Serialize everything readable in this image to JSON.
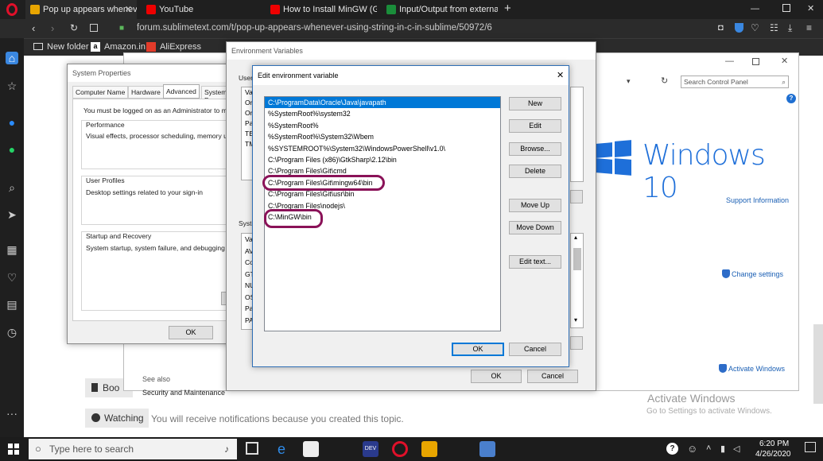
{
  "browser": {
    "tabs": [
      {
        "label": "Pop up appears whenever",
        "color": "#e8a500"
      },
      {
        "label": "YouTube",
        "color": "#e00"
      },
      {
        "label": "How to Install MinGW (GCC",
        "color": "#e00"
      },
      {
        "label": "Input/Output from externa",
        "color": "#1a8d3a"
      }
    ],
    "new_tab": "+",
    "url": "forum.sublimetext.com/t/pop-up-appears-whenever-using-string-in-c-in-sublime/50972/6",
    "bookmarks": [
      {
        "label": "New folder"
      },
      {
        "label": "Amazon.in"
      },
      {
        "label": "AliExpress"
      }
    ]
  },
  "page": {
    "bookmark_label": "Boo",
    "watching_label": "Watching",
    "notice": "You will notifications because you created this topic.",
    "notice_full": "You will receive notifications because you created this topic."
  },
  "control_panel": {
    "search_placeholder": "Search Control Panel",
    "brand": "Windows 10",
    "support": "Support Information",
    "change_settings": "Change settings",
    "activate_link": "Activate Windows",
    "see_also": "See also",
    "security": "Security and Maintenance",
    "watermark_title": "Activate Windows",
    "watermark_sub": "Go to Settings to activate Windows."
  },
  "system_properties": {
    "title": "System Properties",
    "tabs": [
      "Computer Name",
      "Hardware",
      "Advanced",
      "System P"
    ],
    "admin_note": "You must be logged on as an Administrator to make",
    "perf_title": "Performance",
    "perf_desc": "Visual effects, processor scheduling, memory usag",
    "profiles_title": "User Profiles",
    "profiles_desc": "Desktop settings related to your sign-in",
    "startup_title": "Startup and Recovery",
    "startup_desc": "System startup, system failure, and debugging info",
    "ok": "OK"
  },
  "env_vars": {
    "title": "Environment Variables",
    "user_label": "User",
    "user_col": "Va",
    "user_rows": [
      "On",
      "On",
      "Pa",
      "TE",
      "TM"
    ],
    "sys_label": "Syste",
    "sys_col": "Va",
    "sys_rows": [
      "AV",
      "Co",
      "GT",
      "NU",
      "OS",
      "Pa",
      "PA"
    ],
    "ok": "OK",
    "cancel": "Cancel"
  },
  "edit_env": {
    "title": "Edit environment variable",
    "close": "✕",
    "entries": [
      "C:\\ProgramData\\Oracle\\Java\\javapath",
      "%SystemRoot%\\system32",
      "%SystemRoot%",
      "%SystemRoot%\\System32\\Wbem",
      "%SYSTEMROOT%\\System32\\WindowsPowerShell\\v1.0\\",
      "C:\\Program Files (x86)\\GtkSharp\\2.12\\bin",
      "C:\\Program Files\\Git\\cmd",
      "C:\\Program Files\\Git\\mingw64\\bin",
      "C:\\Program Files\\Git\\usr\\bin",
      "C:\\Program Files\\nodejs\\",
      "C:\\MinGW\\bin"
    ],
    "buttons": {
      "new": "New",
      "edit": "Edit",
      "browse": "Browse...",
      "delete": "Delete",
      "up": "Move Up",
      "down": "Move Down",
      "edit_text": "Edit text..."
    },
    "ok": "OK",
    "cancel": "Cancel"
  },
  "taskbar": {
    "search_placeholder": "Type here to search",
    "time": "6:20 PM",
    "date": "4/26/2020"
  }
}
